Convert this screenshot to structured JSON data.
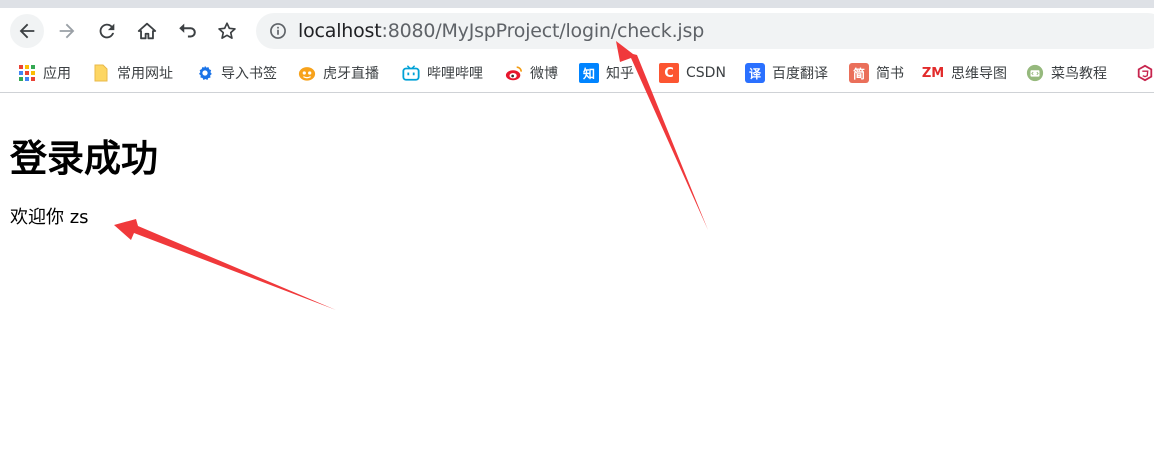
{
  "browser": {
    "url_host": "localhost",
    "url_path": ":8080/MyJspProject/login/check.jsp",
    "bookmarks": [
      {
        "label": "应用",
        "icon": "apps-grid-icon"
      },
      {
        "label": "常用网址",
        "icon": "folder-icon"
      },
      {
        "label": "导入书签",
        "icon": "gear-icon"
      },
      {
        "label": "虎牙直播",
        "icon": "huya-icon"
      },
      {
        "label": "哔哩哔哩",
        "icon": "bilibili-icon"
      },
      {
        "label": "微博",
        "icon": "weibo-icon"
      },
      {
        "label": "知乎",
        "icon": "zhihu-icon"
      },
      {
        "label": "CSDN",
        "icon": "csdn-icon"
      },
      {
        "label": "百度翻译",
        "icon": "baidu-translate-icon"
      },
      {
        "label": "简书",
        "icon": "jianshu-icon"
      },
      {
        "label": "思维导图",
        "icon": "mindmap-icon"
      },
      {
        "label": "菜鸟教程",
        "icon": "runoob-icon"
      }
    ]
  },
  "page": {
    "heading": "登录成功",
    "welcome": "欢迎你 zs"
  },
  "annotations": {
    "arrow_color": "#f0393b"
  },
  "colors": {
    "toolbar_bg": "#ffffff",
    "omnibox_bg": "#f1f3f4",
    "tab_strip": "#dee1e6"
  }
}
